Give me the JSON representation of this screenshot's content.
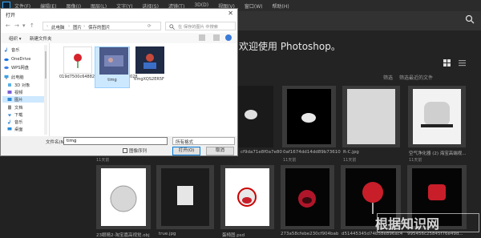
{
  "ps": {
    "menu": [
      "文件(F)",
      "编辑(E)",
      "图像(I)",
      "图层(L)",
      "文字(Y)",
      "选择(S)",
      "滤镜(T)",
      "3D(D)",
      "视图(V)",
      "窗口(W)",
      "帮助(H)"
    ],
    "welcome": "欢迎使用 Photoshop。",
    "filter_label": "筛选",
    "filter_value": "筛选最近的文件",
    "row1": [
      {
        "caption": "",
        "sub": "11天前"
      },
      {
        "caption": "cf9da71e8f0a7e80...",
        "sub": "11天前"
      },
      {
        "caption": "0af1674dd14dd89b7361074...",
        "sub": "11天前"
      },
      {
        "caption": "R-C.jpg",
        "sub": "11天前"
      },
      {
        "caption": "空气净化器 (2) 海宝高端视...",
        "sub": "11天前"
      }
    ],
    "row2": [
      {
        "caption": "23眼睛2-淘宝嘉高视觉.obj",
        "sub": "11天前"
      },
      {
        "caption": "true.jpg",
        "sub": "11天前"
      },
      {
        "caption": "蛋椅图.psd",
        "sub": "11天前"
      },
      {
        "caption": "273a58cfebe230cf904bab95...",
        "sub": "11天前"
      },
      {
        "caption": "d51445345d74b58e896ac49...",
        "sub": "11天前"
      },
      {
        "caption": "995456c25845f76e49d...",
        "sub": "11天前"
      }
    ]
  },
  "dialog": {
    "title": "打开",
    "close": "✕",
    "breadcrumbs": [
      "此电脑",
      "图片",
      "保存的图片"
    ],
    "search_placeholder": "在 保存的图片 中搜索",
    "organize": "组织 ▾",
    "new_folder": "新建文件夹",
    "nav_items": [
      {
        "label": "音乐",
        "icon": "music-icon"
      },
      {
        "label": "OneDrive",
        "icon": "onedrive-icon"
      },
      {
        "label": "WPS网盘",
        "icon": "wps-cloud-icon"
      },
      {
        "label": "此电脑",
        "icon": "computer-icon"
      },
      {
        "label": "3D 对象",
        "icon": "3d-objects-icon"
      },
      {
        "label": "视频",
        "icon": "video-icon"
      },
      {
        "label": "图片",
        "icon": "pictures-icon"
      },
      {
        "label": "文档",
        "icon": "documents-icon"
      },
      {
        "label": "下载",
        "icon": "downloads-icon"
      },
      {
        "label": "音乐",
        "icon": "music-icon"
      },
      {
        "label": "桌面",
        "icon": "desktop-icon"
      }
    ],
    "files": [
      {
        "name": "019d7500c648824d051d6cda0270028"
      },
      {
        "name": "timg"
      },
      {
        "name": "timgXQS2ER5F"
      }
    ],
    "filename_label": "文件名(N):",
    "filename_value": "timg",
    "filetype_value": "所有格式",
    "sequence_label": "图像序列",
    "open_label": "打开(O)",
    "cancel_label": "取消"
  },
  "watermark": "根据知识网"
}
